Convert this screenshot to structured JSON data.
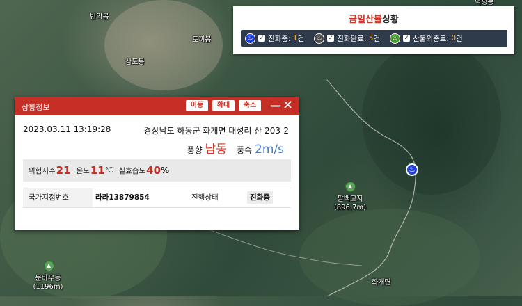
{
  "map": {
    "place_labels": [
      "반약봉",
      "토끼봉",
      "삼도봉",
      "화개면"
    ],
    "peaks": [
      {
        "name": "팔백고지",
        "height": "(896.7m)"
      },
      {
        "name": "문바우등",
        "height": "(1196m)"
      }
    ],
    "fire_marker_icon": "fire-icon",
    "top_right_cut_label": "덕평봉"
  },
  "status_panel": {
    "title_highlight": "금일산불",
    "title_rest": "상황",
    "legend": [
      {
        "icon": "fire-icon",
        "color": "#1f3fd6",
        "label": "진화중:",
        "count": "1",
        "unit": "건"
      },
      {
        "icon": "fire-icon",
        "color": "#4a4a4a",
        "label": "진화완료:",
        "count": "5",
        "unit": "건"
      },
      {
        "icon": "fire-icon",
        "color": "#4e9a35",
        "label": "산불외종료:",
        "count": "0",
        "unit": "건"
      }
    ]
  },
  "info_window": {
    "title": "상황정보",
    "buttons": {
      "move": "이동",
      "zoom_in": "확대",
      "zoom_out": "축소"
    },
    "minimize_icon": "minimize-icon",
    "close_icon": "close-icon",
    "datetime": "2023.03.11 13:19:28",
    "address": "경상남도 하동군 화개면 대성리 산 203-2",
    "wind": {
      "dir_label": "풍향",
      "dir_value": "남동",
      "speed_label": "풍속",
      "speed_value": "2m/s"
    },
    "risk": {
      "index_label": "위험지수",
      "index_value": "21",
      "temp_label": "온도",
      "temp_value": "11",
      "temp_unit": "℃",
      "humidity_label": "실효습도",
      "humidity_value": "40",
      "humidity_unit": "%"
    },
    "grid_label": "국가지점번호",
    "grid_value": "라라13879854",
    "progress_label": "진행상태",
    "progress_value": "진화중"
  },
  "colors": {
    "header": "#c62f26",
    "wind_dir": "#d03a2a",
    "wind_speed": "#3a7ad0",
    "legend_bar": "#2f3a4a"
  }
}
